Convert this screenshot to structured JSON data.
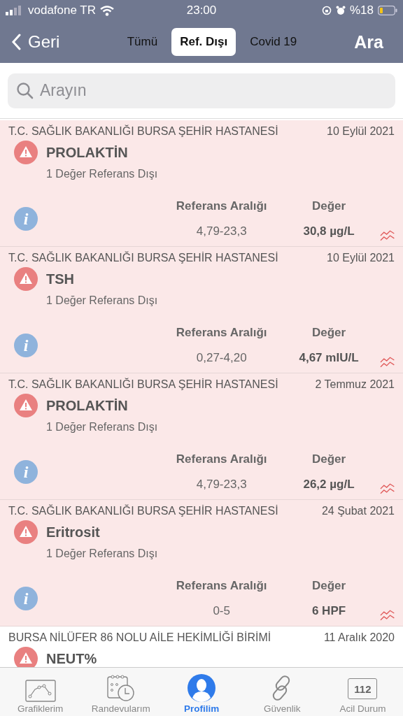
{
  "status_bar": {
    "carrier": "vodafone TR",
    "time": "23:00",
    "battery": "%18"
  },
  "nav": {
    "back": "Geri",
    "action": "Ara",
    "tabs": [
      {
        "label": "Tümü",
        "selected": false
      },
      {
        "label": "Ref. Dışı",
        "selected": true
      },
      {
        "label": "Covid 19",
        "selected": false
      }
    ]
  },
  "search": {
    "placeholder": "Arayın"
  },
  "results": [
    {
      "institution": "T.C. SAĞLIK BAKANLIĞI BURSA ŞEHİR HASTANESİ",
      "date": "10 Eylül 2021",
      "test": "PROLAKTİN",
      "note": "1 Değer Referans Dışı",
      "out_of_range": true,
      "info_icon": "i",
      "range_label": "Referans Aralığı",
      "value_label": "Değer",
      "range": "4,79-23,3",
      "value": "30,8 µg/L"
    },
    {
      "institution": "T.C. SAĞLIK BAKANLIĞI BURSA ŞEHİR HASTANESİ",
      "date": "10 Eylül 2021",
      "test": "TSH",
      "note": "1 Değer Referans Dışı",
      "out_of_range": true,
      "info_icon": "i",
      "range_label": "Referans Aralığı",
      "value_label": "Değer",
      "range": "0,27-4,20",
      "value": "4,67 mIU/L"
    },
    {
      "institution": "T.C. SAĞLIK BAKANLIĞI BURSA ŞEHİR HASTANESİ",
      "date": "2 Temmuz 2021",
      "test": "PROLAKTİN",
      "note": "1 Değer Referans Dışı",
      "out_of_range": true,
      "info_icon": "i",
      "range_label": "Referans Aralığı",
      "value_label": "Değer",
      "range": "4,79-23,3",
      "value": "26,2 µg/L"
    },
    {
      "institution": "T.C. SAĞLIK BAKANLIĞI BURSA ŞEHİR HASTANESİ",
      "date": "24 Şubat 2021",
      "test": "Eritrosit",
      "note": "1 Değer Referans Dışı",
      "out_of_range": true,
      "info_icon": "i",
      "range_label": "Referans Aralığı",
      "value_label": "Değer",
      "range": "0-5",
      "value": "6 HPF"
    },
    {
      "institution": "BURSA NİLÜFER 86 NOLU AİLE HEKİMLİĞİ BİRİMİ",
      "date": "11 Aralık 2020",
      "test": "NEUT%",
      "out_of_range": false
    }
  ],
  "tab_bar": [
    {
      "kind": "chart",
      "label": "Grafiklerim",
      "selected": false
    },
    {
      "kind": "calendar",
      "label": "Randevularım",
      "selected": false
    },
    {
      "kind": "profile",
      "label": "Profilim",
      "selected": true
    },
    {
      "kind": "link",
      "label": "Güvenlik",
      "selected": false
    },
    {
      "kind": "emergency",
      "label": "Acil Durum",
      "icon_text": "112",
      "selected": false
    }
  ]
}
